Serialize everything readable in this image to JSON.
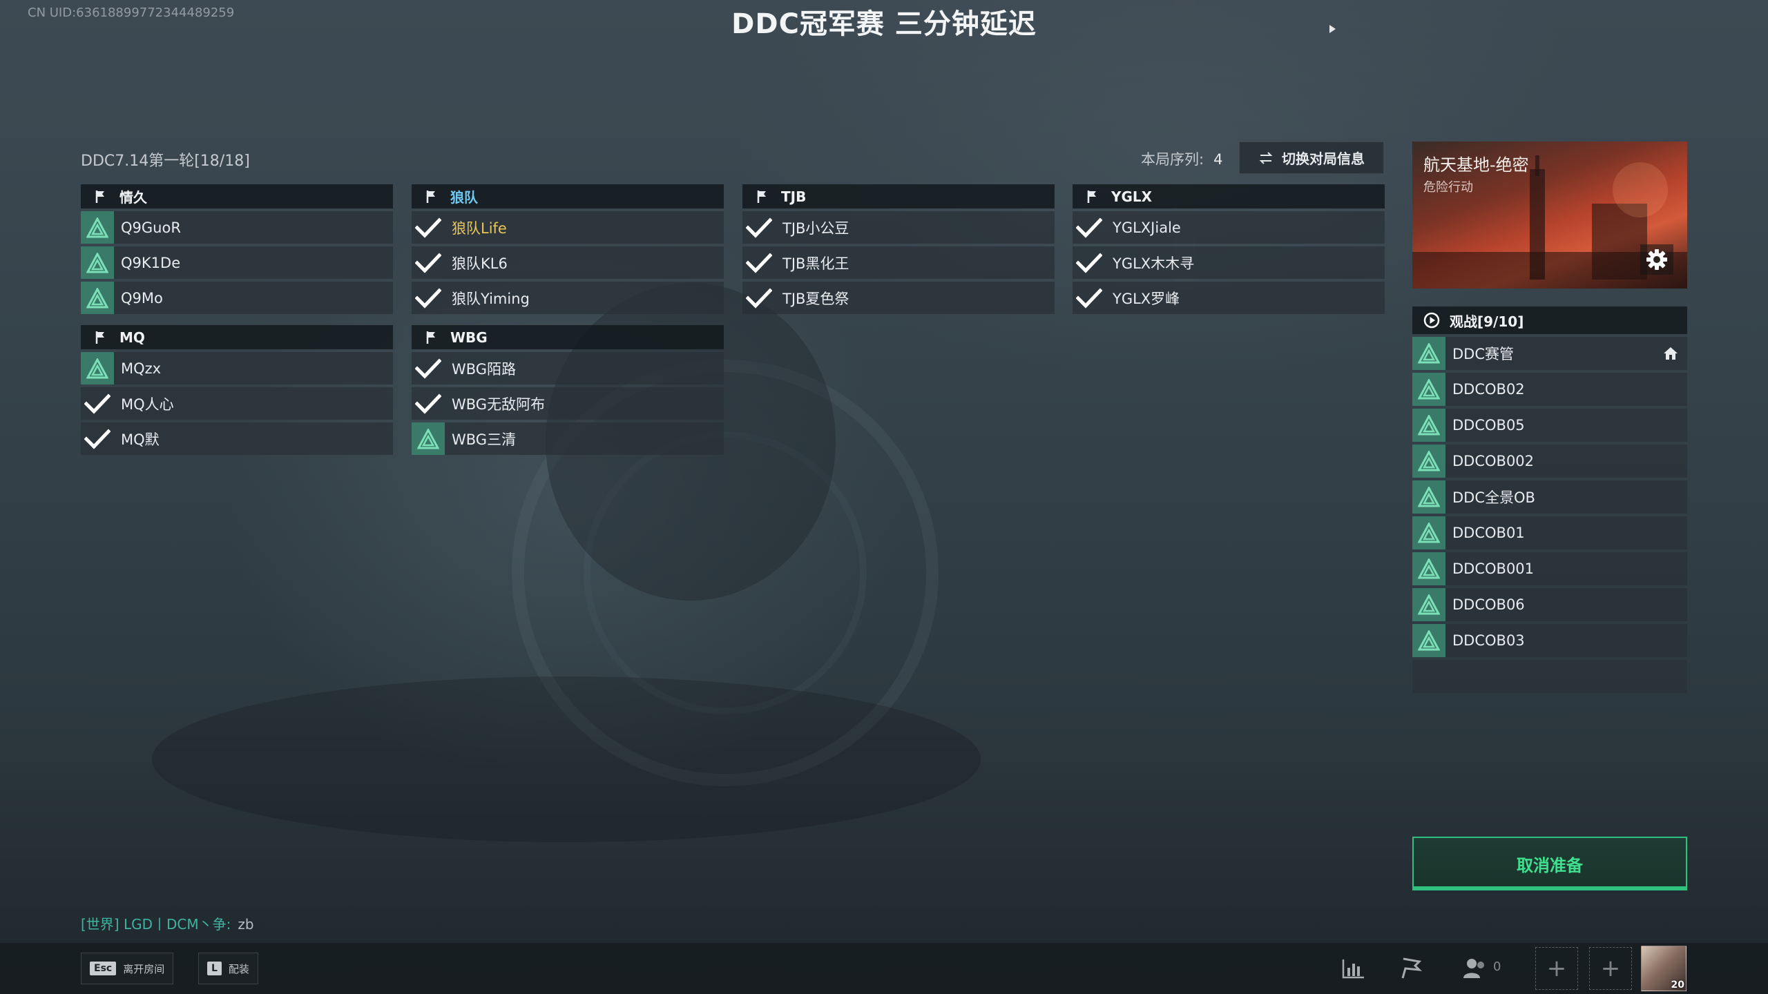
{
  "header": {
    "uid": "CN UID:63618899772344489259",
    "banner": "DDC冠军赛 三分钟延迟"
  },
  "lobby": {
    "round_label": "DDC7.14第一轮[18/18]",
    "sequence_label": "本局序列:",
    "sequence_value": "4",
    "switch_button": "切换对局信息"
  },
  "teams": [
    {
      "name": "情久",
      "accent": false,
      "players": [
        {
          "name": "Q9GuoR",
          "ready": false,
          "highlight": false
        },
        {
          "name": "Q9K1De",
          "ready": false,
          "highlight": false
        },
        {
          "name": "Q9Mo",
          "ready": false,
          "highlight": false
        }
      ]
    },
    {
      "name": "狼队",
      "accent": true,
      "players": [
        {
          "name": "狼队Life",
          "ready": true,
          "highlight": true
        },
        {
          "name": "狼队KL6",
          "ready": true,
          "highlight": false
        },
        {
          "name": "狼队Yiming",
          "ready": true,
          "highlight": false
        }
      ]
    },
    {
      "name": "TJB",
      "accent": false,
      "players": [
        {
          "name": "TJB小公豆",
          "ready": true,
          "highlight": false
        },
        {
          "name": "TJB黑化王",
          "ready": true,
          "highlight": false
        },
        {
          "name": "TJB夏色祭",
          "ready": true,
          "highlight": false
        }
      ]
    },
    {
      "name": "YGLX",
      "accent": false,
      "players": [
        {
          "name": "YGLXJiale",
          "ready": true,
          "highlight": false
        },
        {
          "name": "YGLX木木寻",
          "ready": true,
          "highlight": false
        },
        {
          "name": "YGLX罗峰",
          "ready": true,
          "highlight": false
        }
      ]
    },
    {
      "name": "MQ",
      "accent": false,
      "players": [
        {
          "name": "MQzx",
          "ready": false,
          "highlight": false
        },
        {
          "name": "MQ人心",
          "ready": true,
          "highlight": false
        },
        {
          "name": "MQ默",
          "ready": true,
          "highlight": false
        }
      ]
    },
    {
      "name": "WBG",
      "accent": false,
      "players": [
        {
          "name": "WBG陌路",
          "ready": true,
          "highlight": false
        },
        {
          "name": "WBG无敌阿布",
          "ready": true,
          "highlight": false
        },
        {
          "name": "WBG三清",
          "ready": false,
          "highlight": false
        }
      ]
    }
  ],
  "map": {
    "name": "航天基地-绝密",
    "mode": "危险行动"
  },
  "spectators": {
    "header": "观战[9/10]",
    "list": [
      {
        "name": "DDC赛管",
        "host": true
      },
      {
        "name": "DDCOB02",
        "host": false
      },
      {
        "name": "DDCOB05",
        "host": false
      },
      {
        "name": "DDCOB002",
        "host": false
      },
      {
        "name": "DDC全景OB",
        "host": false
      },
      {
        "name": "DDCOB01",
        "host": false
      },
      {
        "name": "DDCOB001",
        "host": false
      },
      {
        "name": "DDCOB06",
        "host": false
      },
      {
        "name": "DDCOB03",
        "host": false
      }
    ]
  },
  "actions": {
    "cancel_ready": "取消准备"
  },
  "chat": {
    "channel": "[世界] LGD丨DCM丶争:",
    "message": "zb"
  },
  "bottom_bar": {
    "esc_key": "Esc",
    "esc_label": "离开房间",
    "l_key": "L",
    "l_label": "配装",
    "friend_count": "0",
    "avatar_level": "20"
  },
  "icons": {
    "team_flag": "flag-icon",
    "ready": "check-icon",
    "not_ready": "triangle-icon",
    "host": "house-icon",
    "settings": "gear-icon",
    "spectate": "play-circle-icon",
    "switch": "swap-icon"
  },
  "colors": {
    "ready_check": "#ffffff",
    "not_ready_bg": "#3a7a68",
    "triangle": "#7be0b8",
    "team_accent": "#6fc8f2",
    "player_highlight": "#e8c45a",
    "cancel_green": "#2ec27e",
    "chat_green": "#3fb3a0"
  }
}
